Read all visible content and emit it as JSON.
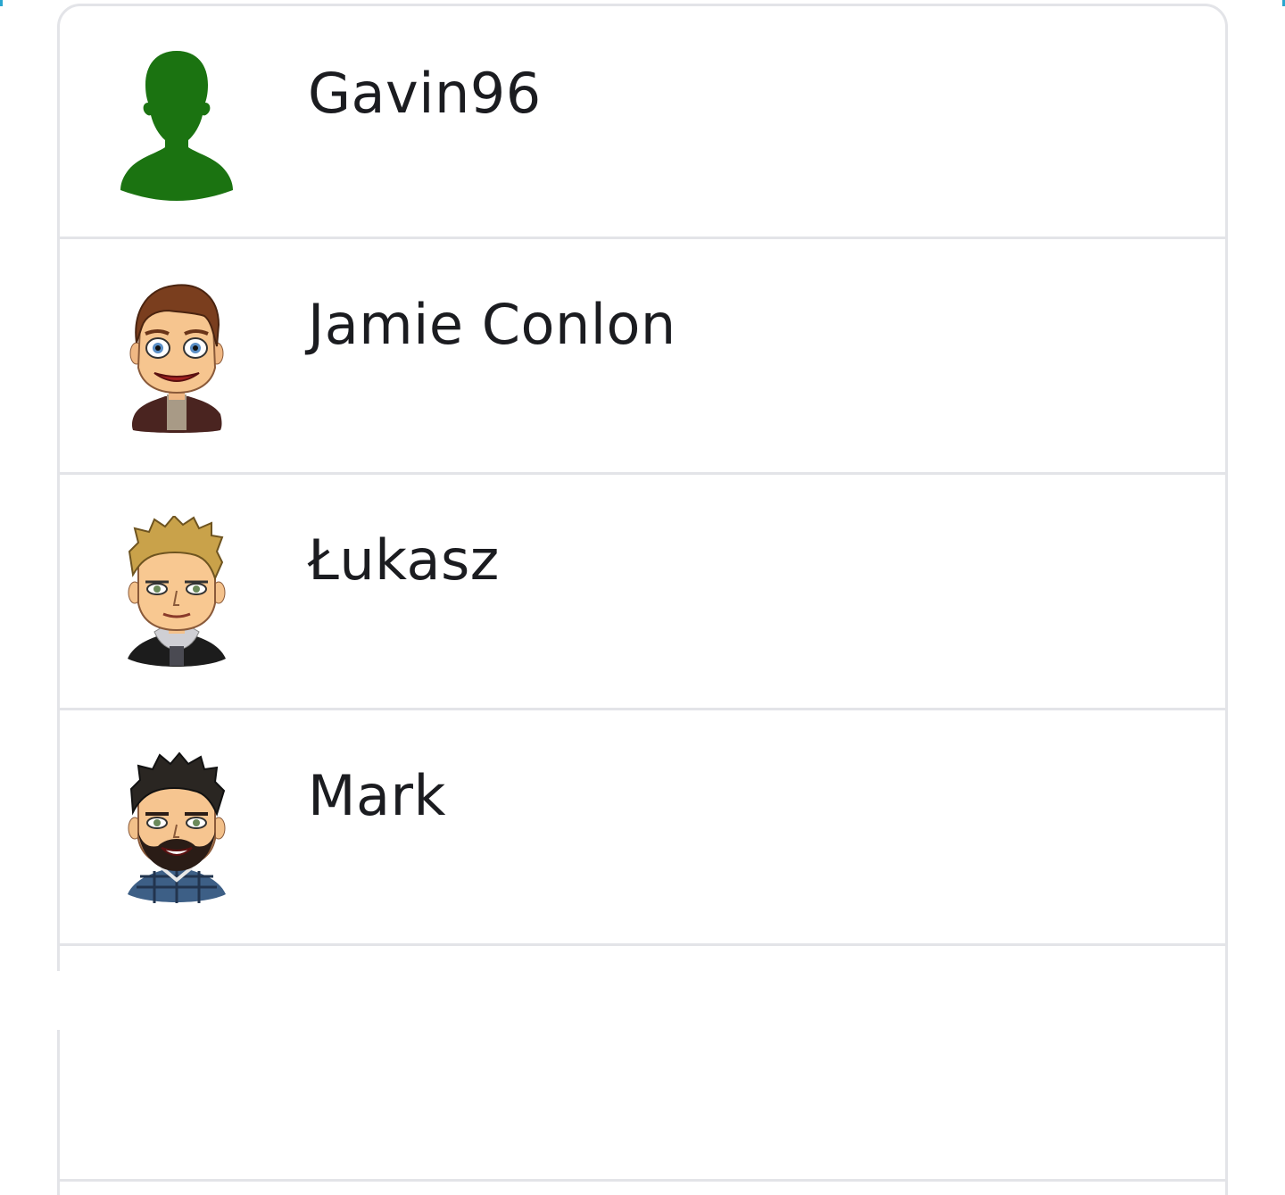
{
  "friends": [
    {
      "name": "Gavin96",
      "avatar": "default-silhouette-avatar"
    },
    {
      "name": "Jamie Conlon",
      "avatar": "bitmoji-avatar"
    },
    {
      "name": "Łukasz",
      "avatar": "bitmoji-avatar"
    },
    {
      "name": "Mark",
      "avatar": "bitmoji-avatar"
    }
  ],
  "colors": {
    "silhouette": "#1b7311",
    "divider": "#e3e4e8",
    "text": "#1b1c20"
  }
}
